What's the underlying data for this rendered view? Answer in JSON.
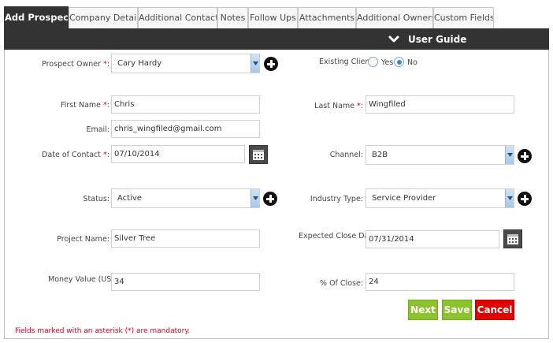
{
  "tabs": [
    {
      "label": "Add Prospect",
      "active": true
    },
    {
      "label": "Company Detail",
      "active": false
    },
    {
      "label": "Additional Contact",
      "active": false
    },
    {
      "label": "Notes",
      "active": false
    },
    {
      "label": "Follow Ups",
      "active": false
    },
    {
      "label": "Attachments",
      "active": false
    },
    {
      "label": "Additional Owners",
      "active": false
    },
    {
      "label": "Custom Fields",
      "active": false
    }
  ],
  "user_guide": {
    "label": "User Guide",
    "icon": "chevron-down-icon"
  },
  "form": {
    "prospect_owner": {
      "label": "Prospect Owner",
      "asterisk": "*",
      "colon": ":",
      "value": "Cary Hardy"
    },
    "existing_client": {
      "label": "Existing Client:",
      "options": [
        "Yes",
        "No"
      ],
      "selected": "No"
    },
    "first_name": {
      "label": "First Name",
      "asterisk": "*",
      "colon": ":",
      "value": "Chris"
    },
    "last_name": {
      "label": "Last Name",
      "asterisk": "*",
      "colon": ":",
      "value": "Wingfiled"
    },
    "email": {
      "label": "Email:",
      "value": "chris_wingfiled@gmail.com"
    },
    "date_of_contact": {
      "label": "Date of Contact",
      "asterisk": "*",
      "colon": ":",
      "value": "07/10/2014"
    },
    "channel": {
      "label": "Channel:",
      "value": "B2B"
    },
    "status": {
      "label": "Status:",
      "value": "Active"
    },
    "industry_type": {
      "label": "Industry Type:",
      "value": "Service Provider"
    },
    "project_name": {
      "label": "Project Name:",
      "value": "Silver Tree"
    },
    "expected_close_date": {
      "label": "Expected Close Date:",
      "value": "07/31/2014"
    },
    "money_value": {
      "label": "Money Value (USD):",
      "value": "34"
    },
    "percent_close": {
      "label": "% Of Close:",
      "value": "24"
    }
  },
  "buttons": {
    "next": "Next",
    "save": "Save",
    "cancel": "Cancel"
  },
  "colors": {
    "next": "#8cc22c",
    "save": "#8cc22c",
    "cancel": "#e00000",
    "header": "#333333",
    "required": "#d9001b"
  },
  "footnote": "Fields marked with an asterisk (*) are mandatory."
}
